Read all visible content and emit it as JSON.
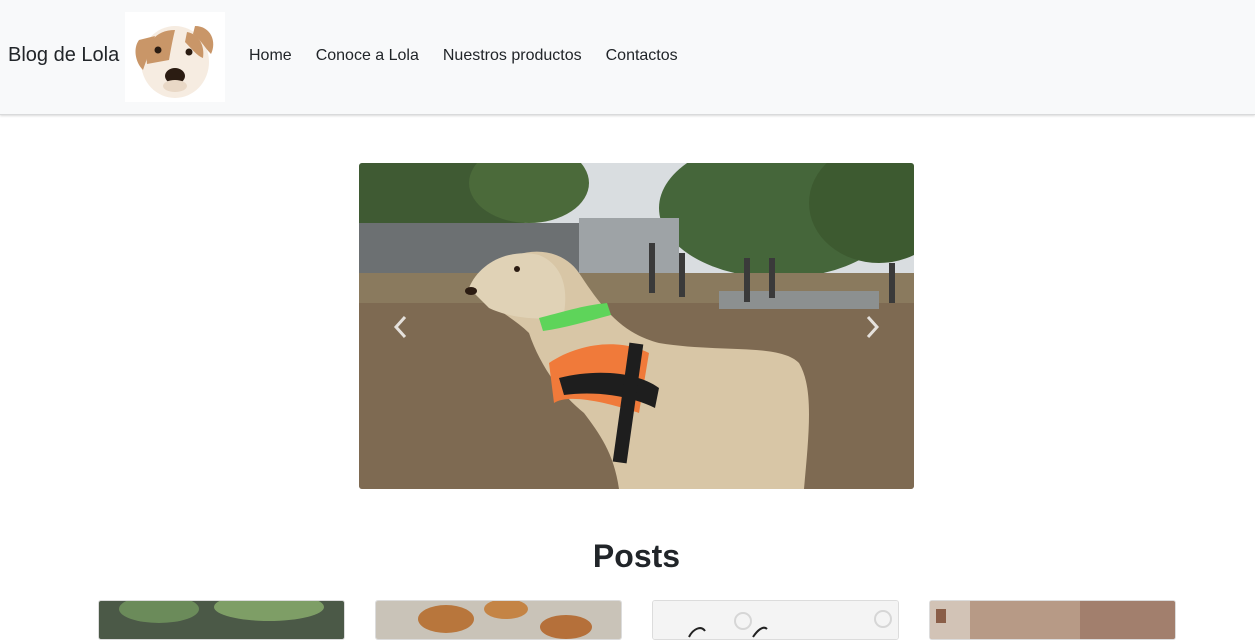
{
  "navbar": {
    "brand": "Blog de Lola",
    "logo_icon": "dog-face-icon",
    "links": [
      "Home",
      "Conoce a Lola",
      "Nuestros productos",
      "Contactos"
    ]
  },
  "carousel": {
    "prev_icon": "chevron-left-icon",
    "next_icon": "chevron-right-icon"
  },
  "posts": {
    "title": "Posts",
    "cards": 4
  },
  "colors": {
    "navbar_bg": "#f8f9fa",
    "text": "#212529"
  }
}
